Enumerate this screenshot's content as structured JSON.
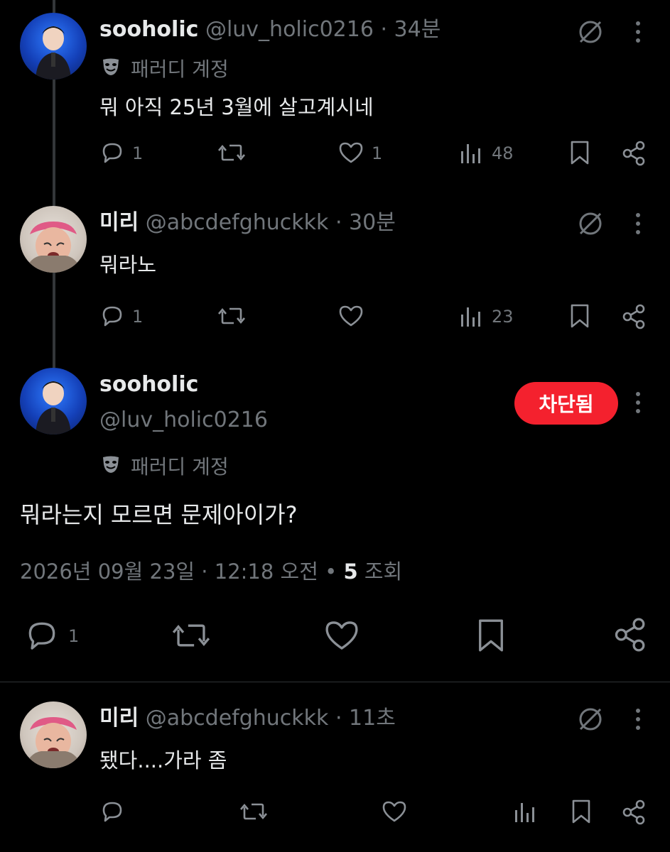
{
  "posts": [
    {
      "name": "sooholic",
      "handle": "@luv_holic0216",
      "time": "34분",
      "label": "패러디 계정",
      "text": "뭐 아직 25년 3월에 살고계시네",
      "replies": "1",
      "likes": "1",
      "views": "48"
    },
    {
      "name": "미리",
      "handle": "@abcdefghuckkk",
      "time": "30분",
      "text": "뭐라노",
      "replies": "1",
      "views": "23"
    },
    {
      "name": "sooholic",
      "handle": "@luv_holic0216",
      "label": "패러디 계정",
      "button": "차단됨",
      "text": "뭐라는지 모르면 문제아이가?",
      "date": "2026년 09월 23일 · 12:18 오전",
      "views_count": "5",
      "views_label": "조회",
      "replies": "1"
    },
    {
      "name": "미리",
      "handle": "@abcdefghuckkk",
      "time": "11초",
      "text": "됐다....가라 좀"
    }
  ],
  "separator": " · "
}
